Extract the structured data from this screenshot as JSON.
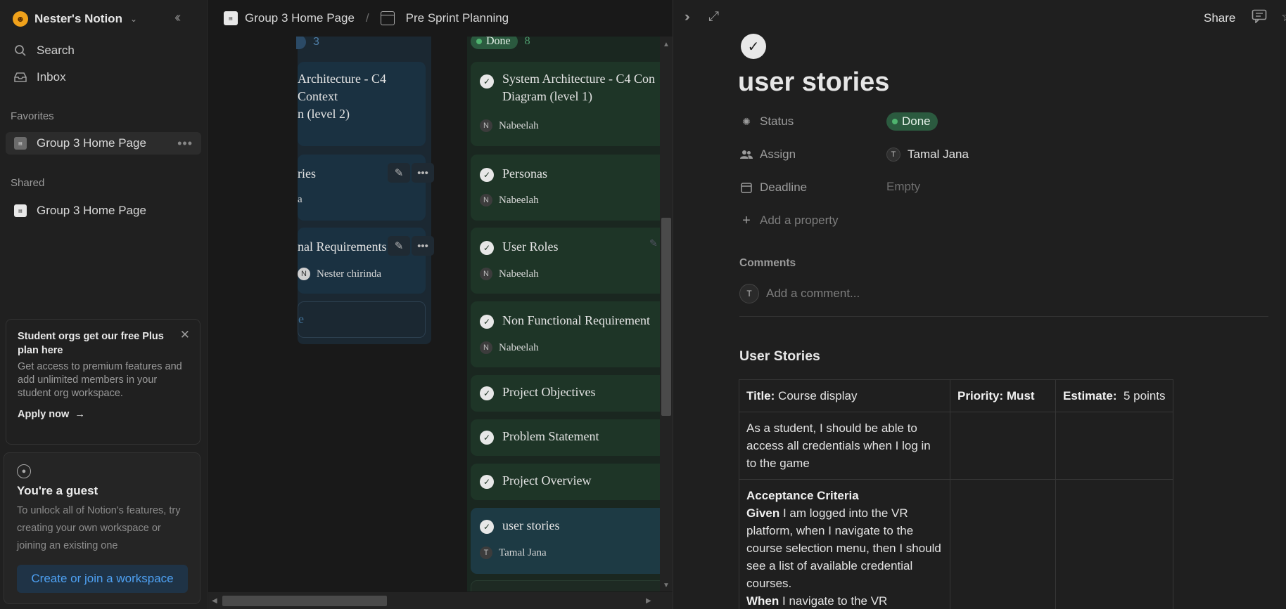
{
  "sidebar": {
    "workspace_name": "Nester's Notion",
    "nav": {
      "search": "Search",
      "inbox": "Inbox"
    },
    "favorites_label": "Favorites",
    "favorites": [
      {
        "label": "Group 3 Home Page"
      }
    ],
    "shared_label": "Shared",
    "shared": [
      {
        "label": "Group 3 Home Page"
      }
    ],
    "promo": {
      "title": "Student orgs get our free Plus plan here",
      "body": "Get access to premium features and add unlimited members in your student org workspace.",
      "link": "Apply now"
    },
    "guest": {
      "title": "You're a guest",
      "body": "To unlock all of Notion's features, try creating your own workspace or joining an existing one",
      "button": "Create or join a workspace"
    }
  },
  "breadcrumb": {
    "home": "Group 3 Home Page",
    "separator": "/",
    "current": "Pre Sprint Planning"
  },
  "board": {
    "left_column": {
      "count": "3",
      "cards": [
        {
          "title_line1": "Architecture - C4 Context",
          "title_line2": "n (level 2)"
        },
        {
          "title": "ries",
          "person": "a"
        },
        {
          "title": "nal Requirements",
          "person": "Nester chirinda",
          "avatar": "N"
        }
      ],
      "new_label": "e"
    },
    "done_column": {
      "status": "Done",
      "count": "8",
      "cards": [
        {
          "title_line1": "System Architecture - C4 Con",
          "title_line2": "Diagram (level 1)",
          "person": "Nabeelah",
          "avatar": "N"
        },
        {
          "title": "Personas",
          "person": "Nabeelah",
          "avatar": "N"
        },
        {
          "title": "User Roles",
          "person": "Nabeelah",
          "avatar": "N"
        },
        {
          "title": "Non Functional Requirement",
          "person": "Nabeelah",
          "avatar": "N"
        },
        {
          "title": "Project Objectives"
        },
        {
          "title": "Problem Statement"
        },
        {
          "title": "Project Overview"
        },
        {
          "title": "user stories",
          "person": "Tamal Jana",
          "avatar": "T"
        }
      ]
    }
  },
  "peek": {
    "share": "Share",
    "title": "user stories",
    "properties": {
      "status_label": "Status",
      "status_value": "Done",
      "assign_label": "Assign",
      "assign_value": "Tamal Jana",
      "assign_avatar": "T",
      "deadline_label": "Deadline",
      "deadline_value": "Empty",
      "add_property": "Add a property"
    },
    "comments_label": "Comments",
    "comment_avatar": "T",
    "comment_placeholder": "Add a comment...",
    "section_heading": "User Stories",
    "table": {
      "title_label": "Title:",
      "title_value": " Course display",
      "priority": "Priority: Must",
      "estimate_label": "Estimate:",
      "estimate_value": "  5 points",
      "story": "As a student, I should be able to access all credentials when I log in to the game",
      "acceptance_heading": "Acceptance Criteria",
      "given_label": "Given",
      "given_text": " I am logged into the VR platform, when I navigate to the course selection menu, then I should see a list of available credential courses.",
      "when_label": "When",
      "when_text": " I navigate to the VR"
    }
  },
  "colors": {
    "done_card": "#1e3527",
    "blue_card": "#1a2f3d",
    "done_badge": "#2b5a3f",
    "link_blue": "#4ea1f3"
  }
}
